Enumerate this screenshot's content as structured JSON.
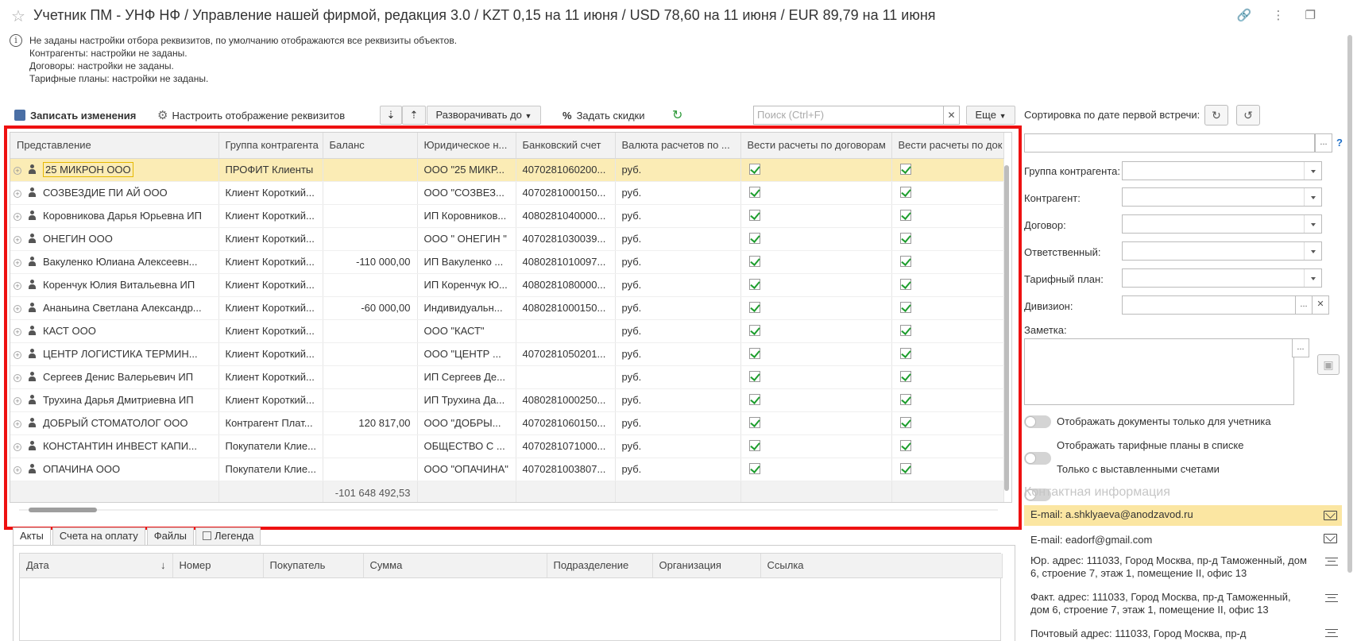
{
  "window": {
    "title": "Учетник ПМ - УНФ НФ / Управление нашей фирмой, редакция 3.0 / KZT 0,15 на 11 июня / USD 78,60 на 11 июня / EUR 89,79 на 11 июня",
    "icons": [
      "star-icon",
      "link-icon",
      "more-icon",
      "restore-icon"
    ]
  },
  "info": {
    "lines": [
      "Не заданы настройки отбора реквизитов, по умолчанию отображаются все реквизиты объектов.",
      "Контрагенты: настройки не заданы.",
      "Договоры: настройки не заданы.",
      "Тарифные планы: настройки не заданы."
    ]
  },
  "toolbar": {
    "save_label": "Записать изменения",
    "configure_label": "Настроить отображение реквизитов",
    "expand_label": "Разворачивать до",
    "discount_label": "Задать скидки",
    "search_placeholder": "Поиск (Ctrl+F)",
    "more_label": "Еще"
  },
  "grid": {
    "columns": [
      "Представление",
      "Группа контрагента",
      "Баланс",
      "Юридическое н...",
      "Банковский счет",
      "Валюта расчетов по ...",
      "Вести расчеты по договорам",
      "Вести расчеты по док"
    ],
    "rows": [
      {
        "name": "25 МИКРОН ООО",
        "group": "ПРОФИТ Клиенты",
        "balance": "",
        "legal": "ООО \"25 МИКР...",
        "account": "4070281060200...",
        "currency": "руб.",
        "by_contracts": true,
        "by_docs": true,
        "selected": true
      },
      {
        "name": "СОЗВЕЗДИЕ ПИ АЙ ООО",
        "group": "Клиент Короткий...",
        "balance": "",
        "legal": "ООО \"СОЗВЕЗ...",
        "account": "4070281000150...",
        "currency": "руб.",
        "by_contracts": true,
        "by_docs": true
      },
      {
        "name": "Коровникова Дарья Юрьевна ИП",
        "group": "Клиент Короткий...",
        "balance": "",
        "legal": "ИП Коровников...",
        "account": "4080281040000...",
        "currency": "руб.",
        "by_contracts": true,
        "by_docs": true
      },
      {
        "name": "ОНЕГИН  ООО",
        "group": "Клиент Короткий...",
        "balance": "",
        "legal": "ООО \" ОНЕГИН \"",
        "account": "4070281030039...",
        "currency": "руб.",
        "by_contracts": true,
        "by_docs": true
      },
      {
        "name": "Вакуленко Юлиана Алексеевн...",
        "group": "Клиент Короткий...",
        "balance": "-110 000,00",
        "legal": "ИП Вакуленко ...",
        "account": "4080281010097...",
        "currency": "руб.",
        "by_contracts": true,
        "by_docs": true
      },
      {
        "name": "Коренчук Юлия Витальевна ИП",
        "group": "Клиент Короткий...",
        "balance": "",
        "legal": "ИП Коренчук Ю...",
        "account": "4080281080000...",
        "currency": "руб.",
        "by_contracts": true,
        "by_docs": true
      },
      {
        "name": "Ананьина Светлана Александр...",
        "group": "Клиент Короткий...",
        "balance": "-60 000,00",
        "legal": "Индивидуальн...",
        "account": "4080281000150...",
        "currency": "руб.",
        "by_contracts": true,
        "by_docs": true
      },
      {
        "name": "КАСТ ООО",
        "group": "Клиент Короткий...",
        "balance": "",
        "legal": "ООО \"КАСТ\"",
        "account": "",
        "currency": "руб.",
        "by_contracts": true,
        "by_docs": true
      },
      {
        "name": "ЦЕНТР ЛОГИСТИКА ТЕРМИН...",
        "group": "Клиент Короткий...",
        "balance": "",
        "legal": "ООО \"ЦЕНТР ...",
        "account": "4070281050201...",
        "currency": "руб.",
        "by_contracts": true,
        "by_docs": true
      },
      {
        "name": "Сергеев Денис Валерьевич ИП",
        "group": "Клиент Короткий...",
        "balance": "",
        "legal": "ИП Сергеев Де...",
        "account": "",
        "currency": "руб.",
        "by_contracts": true,
        "by_docs": true
      },
      {
        "name": "Трухина Дарья Дмитриевна ИП",
        "group": "Клиент Короткий...",
        "balance": "",
        "legal": "ИП Трухина Да...",
        "account": "4080281000250...",
        "currency": "руб.",
        "by_contracts": true,
        "by_docs": true
      },
      {
        "name": "ДОБРЫЙ СТОМАТОЛОГ ООО",
        "group": "Контрагент Плат...",
        "balance": "120 817,00",
        "legal": "ООО \"ДОБРЫ...",
        "account": "4070281060150...",
        "currency": "руб.",
        "by_contracts": true,
        "by_docs": true
      },
      {
        "name": "КОНСТАНТИН ИНВЕСТ КАПИ...",
        "group": "Покупатели Клие...",
        "balance": "",
        "legal": "ОБЩЕСТВО С ...",
        "account": "4070281071000...",
        "currency": "руб.",
        "by_contracts": true,
        "by_docs": true
      },
      {
        "name": "ОПАЧИНА ООО",
        "group": "Покупатели Клие...",
        "balance": "",
        "legal": "ООО \"ОПАЧИНА\"",
        "account": "4070281003807...",
        "currency": "руб.",
        "by_contracts": true,
        "by_docs": true
      }
    ],
    "footer_total": "-101 648 492,53"
  },
  "bottom": {
    "tabs": [
      "Акты",
      "Счета на оплату",
      "Файлы",
      "Легенда"
    ],
    "columns": [
      "Дата",
      "Номер",
      "Покупатель",
      "Сумма",
      "Подразделение",
      "Организация",
      "Ссылка"
    ]
  },
  "right_panel": {
    "sort_label": "Сортировка по дате первой встречи:",
    "help": "?",
    "fields": [
      {
        "label": "Группа контрагента:",
        "value": ""
      },
      {
        "label": "Контрагент:",
        "value": ""
      },
      {
        "label": "Договор:",
        "value": ""
      },
      {
        "label": "Ответственный:",
        "value": ""
      },
      {
        "label": "Тарифный план:",
        "value": ""
      },
      {
        "label": "Дивизион:",
        "value": ""
      }
    ],
    "note_label": "Заметка:",
    "toggles": [
      "Отображать документы только для учетника",
      "Отображать тарифные планы в списке",
      "Только с выставленными счетами"
    ],
    "contact_header": "Контактная информация",
    "contacts": [
      {
        "text": "E-mail: a.shklyaeva@anodzavod.ru",
        "icon": "mail-icon",
        "selected": true
      },
      {
        "text": "E-mail: eadorf@gmail.com",
        "icon": "mail-icon"
      },
      {
        "text": "Юр. адрес: 111033, Город Москва, пр-д Таможенный, дом 6, строение 7, этаж 1, помещение II, офис 13",
        "icon": "menu-icon"
      },
      {
        "text": "Факт. адрес: 111033, Город Москва, пр-д Таможенный, дом 6, строение 7, этаж 1, помещение II, офис 13",
        "icon": "menu-icon"
      },
      {
        "text": "Почтовый адрес: 111033, Город Москва, пр-д",
        "icon": "menu-icon"
      }
    ]
  },
  "colors": {
    "selection": "#fbecb5",
    "highlight_frame": "#ee1111",
    "check": "#1e9e2e",
    "accent": "#4a6fa5"
  }
}
